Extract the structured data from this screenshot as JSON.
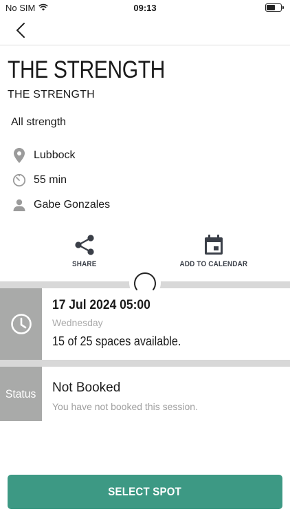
{
  "status_bar": {
    "carrier": "No SIM",
    "time": "09:13"
  },
  "class": {
    "title": "THE STRENGTH",
    "subtitle": "THE STRENGTH",
    "category": "All strength",
    "location": "Lubbock",
    "duration": "55 min",
    "instructor": "Gabe Gonzales"
  },
  "actions": {
    "share_label": "SHARE",
    "calendar_label": "ADD TO CALENDAR"
  },
  "session": {
    "date_time": "17 Jul 2024  05:00",
    "weekday": "Wednesday",
    "availability": "15 of 25 spaces available."
  },
  "booking": {
    "status_label": "Status",
    "status": "Not Booked",
    "description": "You have not booked this session."
  },
  "cta": {
    "label": "SELECT SPOT"
  },
  "colors": {
    "accent": "#3d9984",
    "side_box": "#a9aaa9",
    "icon": "#3a3f48",
    "muted": "#a0a0a0"
  }
}
